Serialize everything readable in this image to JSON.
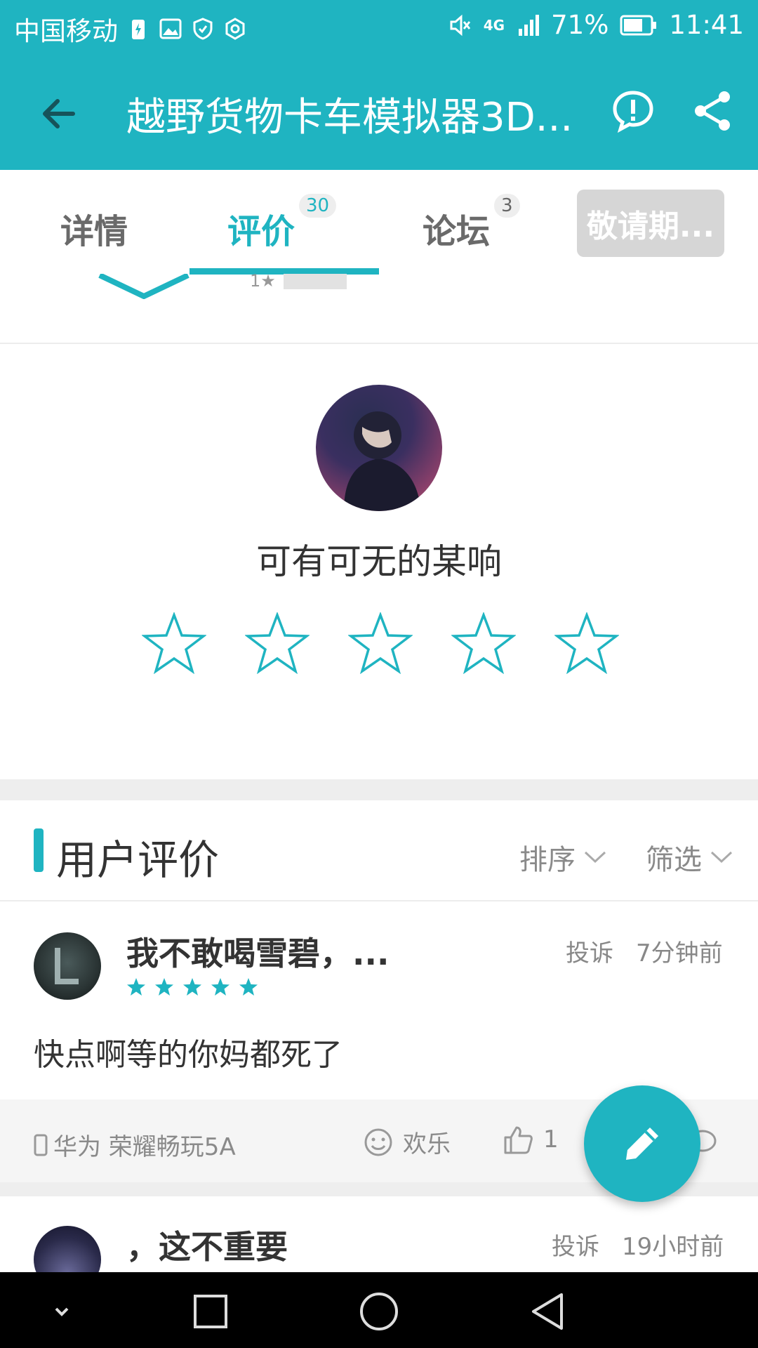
{
  "status_bar": {
    "carrier": "中国移动",
    "network": "4G",
    "battery": "71%",
    "time": "11:41",
    "icons": [
      "battery-charging-icon",
      "image-icon",
      "shield-icon",
      "settings-icon",
      "mute-icon",
      "signal-icon",
      "battery-icon"
    ]
  },
  "header": {
    "title": "越野货物卡车模拟器3D...",
    "back_icon": "back-arrow-icon",
    "report_icon": "alert-icon",
    "share_icon": "share-icon"
  },
  "tabs": [
    {
      "label": "详情",
      "badge": "",
      "active": false
    },
    {
      "label": "评价",
      "badge": "30",
      "active": true
    },
    {
      "label": "论坛",
      "badge": "3",
      "active": false
    }
  ],
  "coming_soon_label": "敬请期...",
  "summary_remnant": {
    "star_label": "1★"
  },
  "my_rating": {
    "username": "可有可无的某响",
    "stars": 5,
    "filled": 0
  },
  "reviews_section": {
    "title": "用户评价",
    "sort_label": "排序",
    "filter_label": "筛选"
  },
  "reviews": [
    {
      "name": "我不敢喝雪碧，...",
      "rating": 5,
      "report_label": "投诉",
      "time": "7分钟前",
      "body": "快点啊等的你妈都死了",
      "device": "华为 荣耀畅玩5A",
      "mood": "欢乐",
      "likes": "1"
    },
    {
      "name": "，这不重要",
      "report_label": "投诉",
      "time": "19小时前"
    }
  ],
  "colors": {
    "accent": "#1fb4c1",
    "text": "#333333",
    "muted": "#8a8a8a"
  }
}
